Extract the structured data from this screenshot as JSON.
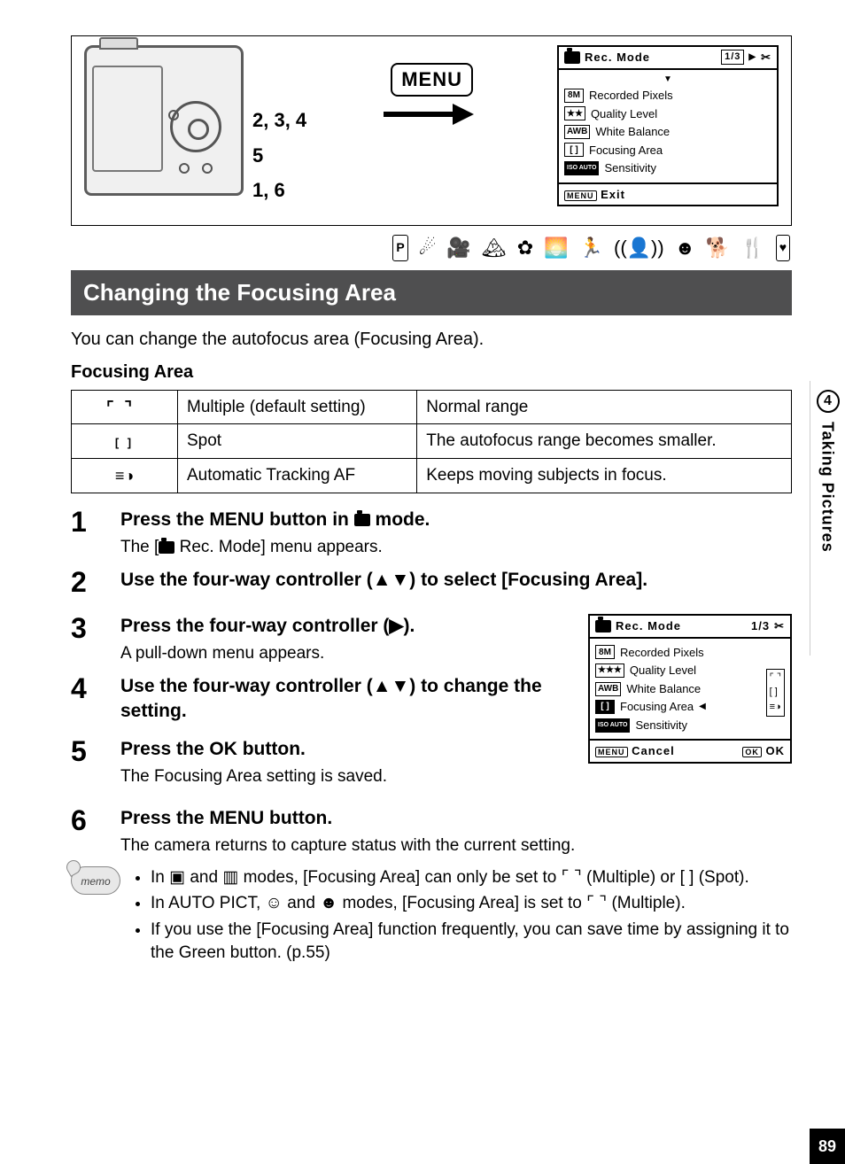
{
  "side_tab": {
    "chapter_num": "4",
    "chapter_title": "Taking Pictures"
  },
  "page_number": "89",
  "diagram": {
    "step_refs": [
      "2, 3, 4",
      "5",
      "1, 6"
    ],
    "menu_button": "MENU"
  },
  "lcd_top": {
    "title": "Rec. Mode",
    "page": "1/3",
    "items": [
      {
        "badge": "8M",
        "label": "Recorded Pixels"
      },
      {
        "badge": "★★",
        "label": "Quality Level"
      },
      {
        "badge": "AWB",
        "label": "White Balance"
      },
      {
        "badge": "[ ]",
        "label": "Focusing Area"
      },
      {
        "badge": "ISO AUTO",
        "label": "Sensitivity"
      }
    ],
    "footer_label": "Exit",
    "footer_key": "MENU"
  },
  "mode_icons": [
    "P",
    "night",
    "movie",
    "landscape",
    "flower",
    "sunset",
    "sport",
    "portrait",
    "kids",
    "pet",
    "food",
    "frame"
  ],
  "section_title": "Changing the Focusing Area",
  "intro": "You can change the autofocus area (Focusing Area).",
  "table_title": "Focusing Area",
  "focus_table": [
    {
      "icon": "multi",
      "name": "Multiple (default setting)",
      "desc": "Normal range"
    },
    {
      "icon": "spot",
      "name": "Spot",
      "desc": "The autofocus range becomes smaller."
    },
    {
      "icon": "track",
      "name": "Automatic Tracking AF",
      "desc": "Keeps moving subjects in focus."
    }
  ],
  "steps": {
    "s1": {
      "title_pre": "Press the ",
      "title_kw": "MENU",
      "title_post": " button in ",
      "title_tail": " mode.",
      "desc_pre": "The [",
      "desc_post": " Rec. Mode] menu appears."
    },
    "s2": {
      "title": "Use the four-way controller (▲▼) to select [Focusing Area]."
    },
    "s3": {
      "title": "Press the four-way controller (▶).",
      "desc": "A pull-down menu appears."
    },
    "s4": {
      "title": "Use the four-way controller (▲▼) to change the setting."
    },
    "s5": {
      "title_pre": "Press the ",
      "title_kw": "OK",
      "title_post": " button.",
      "desc": "The Focusing Area setting is saved."
    },
    "s6": {
      "title": "Press the MENU button.",
      "desc": "The camera returns to capture status with the current setting."
    }
  },
  "lcd_step": {
    "title": "Rec. Mode",
    "page": "1/3",
    "items": [
      {
        "badge": "8M",
        "label": "Recorded Pixels"
      },
      {
        "badge": "★★★",
        "label": "Quality Level"
      },
      {
        "badge": "AWB",
        "label": "White Balance"
      },
      {
        "badge": "[ ]",
        "label": "Focusing Area",
        "active": true
      },
      {
        "badge": "ISO AUTO",
        "label": "Sensitivity"
      }
    ],
    "dropdown": [
      "⌜ ⌝",
      "[ ]",
      "≡◑"
    ],
    "footer_left_key": "MENU",
    "footer_left": "Cancel",
    "footer_right_key": "OK",
    "footer_right": "OK"
  },
  "memo": {
    "label": "memo",
    "items": [
      "In ▣ and ▥ modes, [Focusing Area] can only be set to ⌜  ⌝ (Multiple) or [ ] (Spot).",
      "In AUTO PICT, ☺ and ☻ modes, [Focusing Area] is set to ⌜  ⌝ (Multiple).",
      "If you use the [Focusing Area] function frequently, you can save time by assigning it to the Green button. (p.55)"
    ]
  }
}
